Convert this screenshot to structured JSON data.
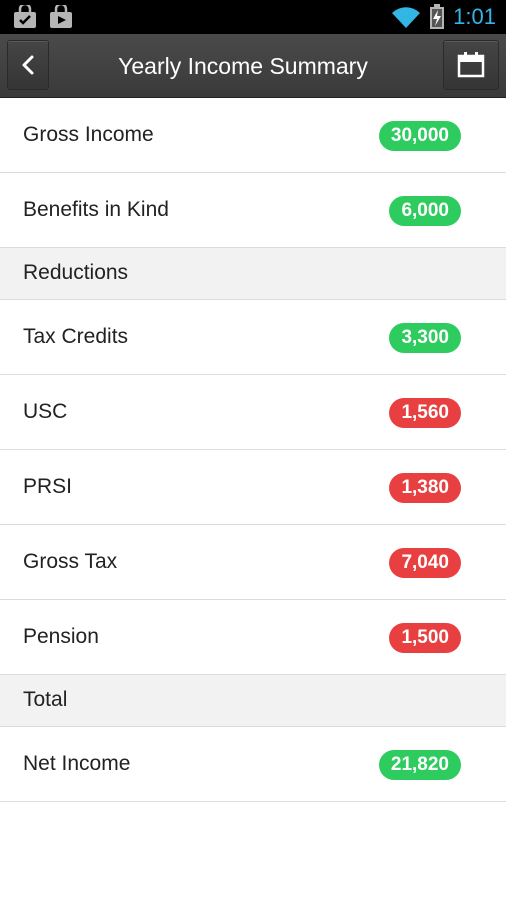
{
  "status_bar": {
    "time": "1:01"
  },
  "header": {
    "title": "Yearly Income Summary"
  },
  "colors": {
    "positive": "#2ecc5e",
    "negative": "#e84040",
    "accent": "#33b5e5"
  },
  "rows": {
    "gross_income": {
      "label": "Gross Income",
      "value": "30,000"
    },
    "benefits_in_kind": {
      "label": "Benefits in Kind",
      "value": "6,000"
    },
    "reductions_header": {
      "label": "Reductions"
    },
    "tax_credits": {
      "label": "Tax Credits",
      "value": "3,300"
    },
    "usc": {
      "label": "USC",
      "value": "1,560"
    },
    "prsi": {
      "label": "PRSI",
      "value": "1,380"
    },
    "gross_tax": {
      "label": "Gross Tax",
      "value": "7,040"
    },
    "pension": {
      "label": "Pension",
      "value": "1,500"
    },
    "total_header": {
      "label": "Total"
    },
    "net_income": {
      "label": "Net Income",
      "value": "21,820"
    }
  }
}
